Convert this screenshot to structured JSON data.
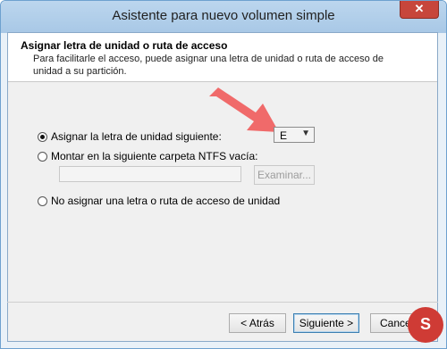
{
  "window": {
    "title": "Asistente para nuevo volumen simple",
    "close_label": "✕"
  },
  "header": {
    "title": "Asignar letra de unidad o ruta de acceso",
    "description": "Para facilitarle el acceso, puede asignar una letra de unidad o ruta de acceso de unidad a su partición."
  },
  "options": {
    "assign_letter": {
      "label": "Asignar la letra de unidad siguiente:",
      "checked": true
    },
    "mount_folder": {
      "label": "Montar en la siguiente carpeta NTFS vacía:",
      "checked": false
    },
    "no_assign": {
      "label": "No asignar una letra o ruta de acceso de unidad",
      "checked": false
    }
  },
  "drive_letter": {
    "selected": "E"
  },
  "mount_path": {
    "value": ""
  },
  "buttons": {
    "browse": "Examinar...",
    "back": "< Atrás",
    "next": "Siguiente >",
    "cancel": "Cancelar"
  },
  "logo": {
    "letter": "S"
  },
  "colors": {
    "arrow": "#f06a6a",
    "accent": "#3c7fb1",
    "logo": "#cf3b35"
  },
  "icons": {
    "close": "close-icon",
    "arrow": "red-arrow-annotation",
    "dropdown": "chevron-down-icon"
  }
}
